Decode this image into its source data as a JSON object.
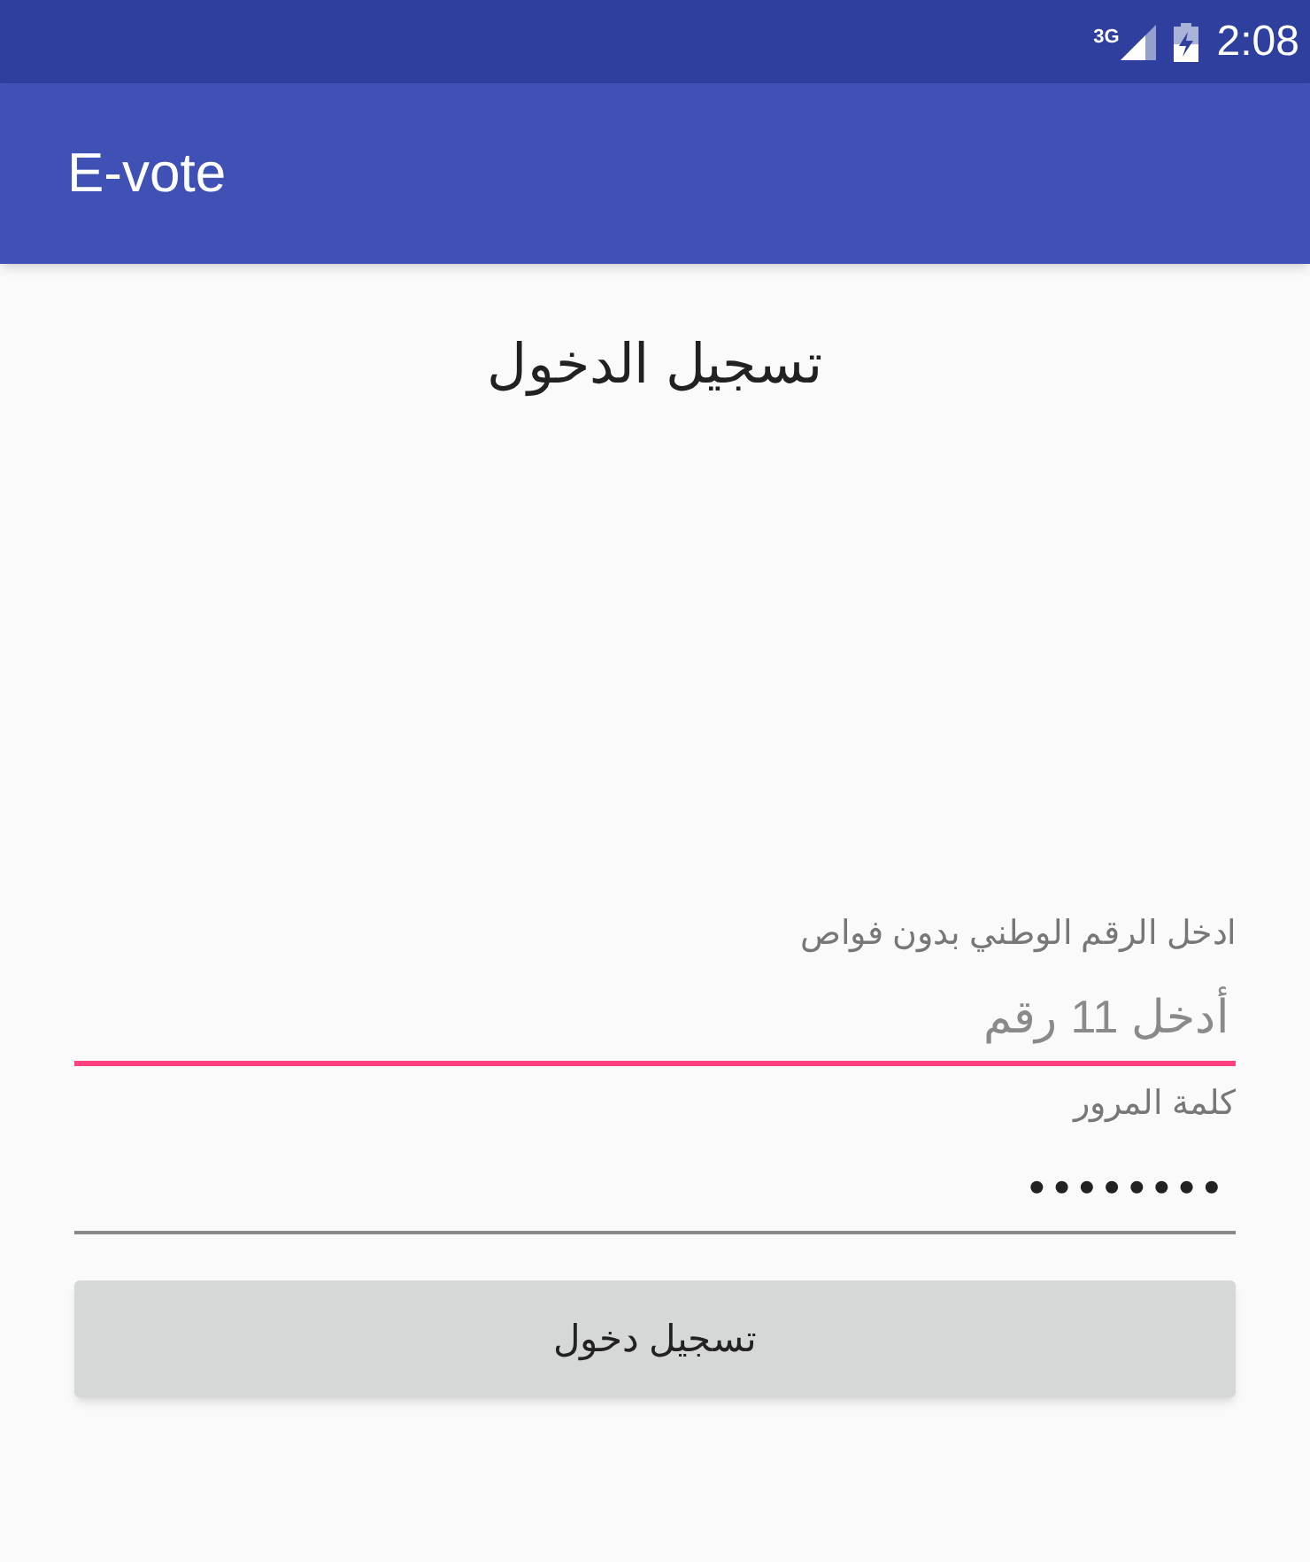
{
  "status_bar": {
    "network": "3G",
    "time": "2:08"
  },
  "app_bar": {
    "title": "E-vote"
  },
  "heading": "تسجيل الدخول",
  "fields": [
    {
      "label": "ادخل الرقم الوطني بدون فواص",
      "placeholder": "أدخل 11 رقم",
      "focused": true
    },
    {
      "label": "كلمة المرور",
      "value": "••••••••",
      "focused": false
    }
  ],
  "button": "تسجيل دخول"
}
